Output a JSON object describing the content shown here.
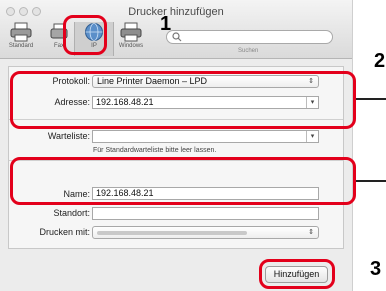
{
  "window": {
    "title": "Drucker hinzufügen"
  },
  "toolbar": {
    "buttons": [
      {
        "label": "Standard",
        "icon": "printer-icon"
      },
      {
        "label": "Fax",
        "icon": "fax-icon"
      },
      {
        "label": "IP",
        "icon": "ip-globe-icon",
        "selected": true
      },
      {
        "label": "Windows",
        "icon": "windows-printer-icon"
      }
    ],
    "search_label": "Suchen"
  },
  "form": {
    "protocol_label": "Protokoll:",
    "protocol_value": "Line Printer Daemon – LPD",
    "address_label": "Adresse:",
    "address_value": "192.168.48.21",
    "queue_label": "Warteliste:",
    "queue_value": "",
    "queue_hint": "Für Standardwarteliste bitte leer lassen.",
    "name_label": "Name:",
    "name_value": "192.168.48.21",
    "location_label": "Standort:",
    "location_value": "",
    "print_with_label": "Drucken mit:"
  },
  "add_button": "Hinzufügen",
  "annotations": {
    "step1": "1",
    "step2": "2",
    "step3": "3",
    "highlight_color": "#e3001b"
  }
}
